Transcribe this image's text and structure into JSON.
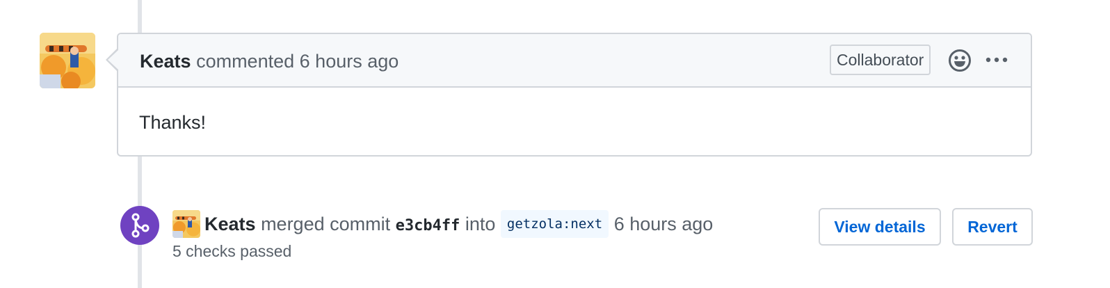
{
  "comment": {
    "author": "Keats",
    "action": "commented",
    "time": "6 hours ago",
    "badge": "Collaborator",
    "body": "Thanks!"
  },
  "icons": {
    "reaction": "smiley-icon",
    "more": "kebab-horizontal-icon",
    "merge": "git-merge-icon"
  },
  "merge_event": {
    "author": "Keats",
    "action": "merged commit",
    "sha": "e3cb4ff",
    "into": "into",
    "branch": "getzola:next",
    "time": "6 hours ago",
    "checks": "5 checks passed",
    "view_details_label": "View details",
    "revert_label": "Revert"
  },
  "colors": {
    "merge_purple": "#6f42c1",
    "link_blue": "#0366d6",
    "border": "#d1d5da",
    "header_bg": "#f6f8fa"
  }
}
